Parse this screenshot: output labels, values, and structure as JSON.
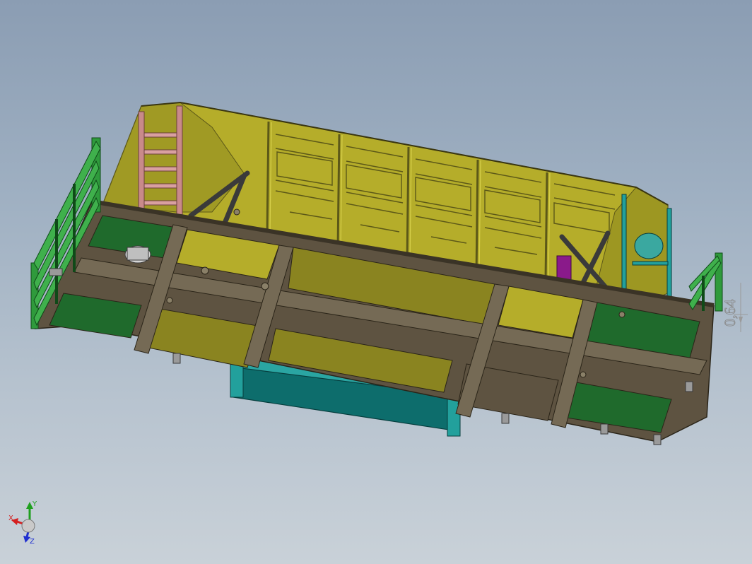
{
  "viewport": {
    "background": "#9fb0c2",
    "model_colors": {
      "hopper_body": "#b5ad2a",
      "hopper_body_dark": "#8a8420",
      "underframe": "#5e5341",
      "underframe_light": "#756a55",
      "rails": "#2f9a3c",
      "end_platform_floor": "#1f6a2c",
      "ladder": "#c98a8a",
      "door_mechanism": "#12807f",
      "door_mechanism_light": "#2aa5a2",
      "actuator": "#8a1a8a",
      "brace": "#3a3a3a"
    }
  },
  "triad": {
    "x_label": "X",
    "y_label": "Y",
    "z_label": "Z",
    "x_color": "#d42020",
    "y_color": "#1fa01f",
    "z_color": "#2030d0"
  },
  "dimension": {
    "text": "0,64"
  }
}
